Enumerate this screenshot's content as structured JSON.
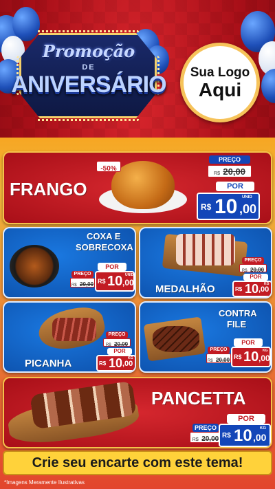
{
  "header": {
    "title_line1": "Promoção",
    "title_line2": "DE",
    "title_line3": "ANIVERSÁRIO",
    "logo_line1": "Sua Logo",
    "logo_line2": "Aqui"
  },
  "products": [
    {
      "name": "FRANGO",
      "discount_badge": "-50%",
      "price_label": "PREÇO",
      "old_currency": "R$",
      "old_price": "20,00",
      "new_label": "POR",
      "new_currency": "R$",
      "new_int": "10",
      "new_cents": ",00",
      "unit": "UNID"
    },
    {
      "name_line1": "COXA E",
      "name_line2": "SOBRECOXA",
      "new_label": "POR",
      "price_label": "PREÇO",
      "old_currency": "R$",
      "old_price": "20,00",
      "new_currency": "R$",
      "new_int": "10",
      "new_cents": ",00",
      "unit": "UNID"
    },
    {
      "name": "MEDALHÃO",
      "price_label": "PREÇO",
      "old_currency": "R$",
      "old_price": "20,00",
      "new_label": "POR",
      "new_currency": "R$",
      "new_int": "10",
      "new_cents": ",00",
      "unit": "KG"
    },
    {
      "name": "PICANHA",
      "price_label": "PREÇO",
      "old_currency": "R$",
      "old_price": "20,00",
      "new_label": "POR",
      "new_currency": "R$",
      "new_int": "10",
      "new_cents": ",00",
      "unit": "KG"
    },
    {
      "name_line1": "CONTRA",
      "name_line2": "FILE",
      "new_label": "POR",
      "price_label": "PREÇO",
      "old_currency": "R$",
      "old_price": "20,00",
      "new_currency": "R$",
      "new_int": "10",
      "new_cents": ",00",
      "unit": "KG"
    },
    {
      "name": "PANCETTA",
      "new_label": "POR",
      "price_label": "PREÇO",
      "old_currency": "R$",
      "old_price": "20,00",
      "new_currency": "R$",
      "new_int": "10",
      "new_cents": ",00",
      "unit": "KG"
    }
  ],
  "banner": "Crie seu encarte com este tema!",
  "footnote": "*Imagens Meramente Ilustrativas",
  "colors": {
    "red": "#c21b23",
    "blue": "#1346b8",
    "gold": "#f5c24a",
    "banner_yellow": "#ffd23a"
  }
}
